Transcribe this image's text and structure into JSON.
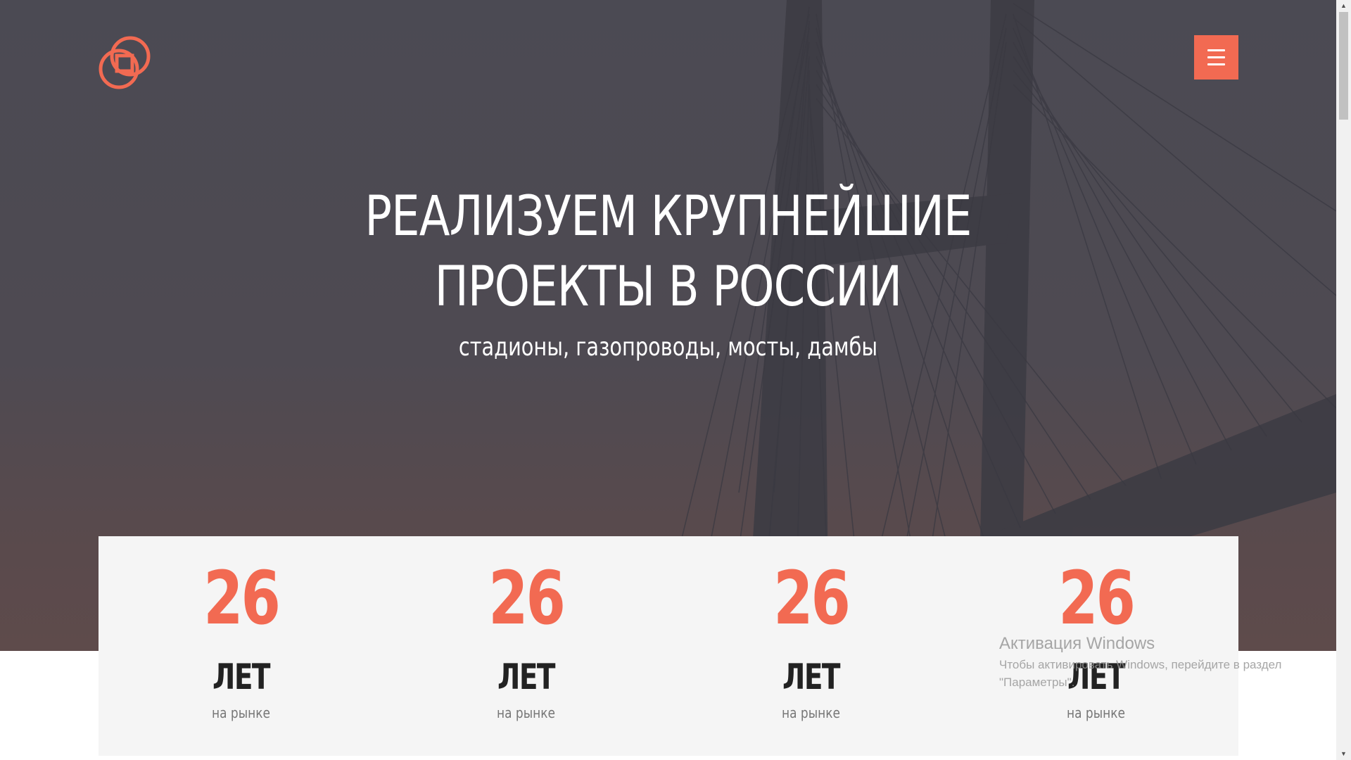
{
  "header": {
    "logo_icon": "interlocked-squares-logo-icon",
    "menu_icon": "hamburger-menu-icon",
    "accent_color": "#f26a52"
  },
  "hero": {
    "title_line1": "РЕАЛИЗУЕМ КРУПНЕЙШИЕ",
    "title_line2": "ПРОЕКТЫ В РОССИИ",
    "subtitle": "стадионы, газопроводы, мосты, дамбы",
    "background": "cable-stayed-bridge-photo"
  },
  "stats": [
    {
      "number": "26",
      "unit": "ЛЕТ",
      "caption": "на рынке"
    },
    {
      "number": "26",
      "unit": "ЛЕТ",
      "caption": "на рынке"
    },
    {
      "number": "26",
      "unit": "ЛЕТ",
      "caption": "на рынке"
    },
    {
      "number": "26",
      "unit": "ЛЕТ",
      "caption": "на рынке"
    }
  ],
  "watermark": {
    "title": "Активация Windows",
    "text": "Чтобы активировать Windows, перейдите в раздел \"Параметры\"."
  }
}
